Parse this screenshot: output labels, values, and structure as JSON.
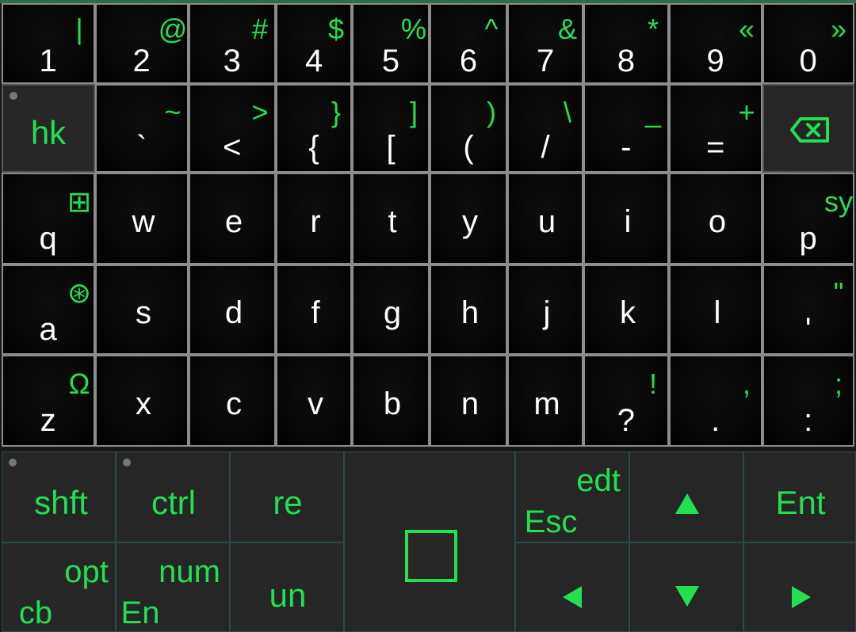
{
  "keyboard": {
    "row1": [
      {
        "main": "1",
        "alt": "|"
      },
      {
        "main": "2",
        "alt": "@"
      },
      {
        "main": "3",
        "alt": "#"
      },
      {
        "main": "4",
        "alt": "$"
      },
      {
        "main": "5",
        "alt": "%"
      },
      {
        "main": "6",
        "alt": "^"
      },
      {
        "main": "7",
        "alt": "&"
      },
      {
        "main": "8",
        "alt": "*"
      },
      {
        "main": "9",
        "alt": "«"
      },
      {
        "main": "0",
        "alt": "»"
      }
    ],
    "row2": [
      {
        "main": "hk",
        "alt": ""
      },
      {
        "main": "`",
        "alt": "~"
      },
      {
        "main": "<",
        "alt": ">"
      },
      {
        "main": "{",
        "alt": "}"
      },
      {
        "main": "[",
        "alt": "]"
      },
      {
        "main": "(",
        "alt": ")"
      },
      {
        "main": "/",
        "alt": "\\"
      },
      {
        "main": "-",
        "alt": "_"
      },
      {
        "main": "=",
        "alt": "+"
      },
      {
        "main": "",
        "alt": "",
        "icon": "backspace-icon"
      }
    ],
    "row3": [
      {
        "main": "q",
        "alt": "⊞"
      },
      {
        "main": "w",
        "alt": ""
      },
      {
        "main": "e",
        "alt": ""
      },
      {
        "main": "r",
        "alt": ""
      },
      {
        "main": "t",
        "alt": ""
      },
      {
        "main": "y",
        "alt": ""
      },
      {
        "main": "u",
        "alt": ""
      },
      {
        "main": "i",
        "alt": ""
      },
      {
        "main": "o",
        "alt": ""
      },
      {
        "main": "p",
        "alt": "sy"
      }
    ],
    "row4": [
      {
        "main": "a",
        "alt": "⊛"
      },
      {
        "main": "s",
        "alt": ""
      },
      {
        "main": "d",
        "alt": ""
      },
      {
        "main": "f",
        "alt": ""
      },
      {
        "main": "g",
        "alt": ""
      },
      {
        "main": "h",
        "alt": ""
      },
      {
        "main": "j",
        "alt": ""
      },
      {
        "main": "k",
        "alt": ""
      },
      {
        "main": "l",
        "alt": ""
      },
      {
        "main": "'",
        "alt": "\""
      }
    ],
    "row5": [
      {
        "main": "z",
        "alt": "Ω"
      },
      {
        "main": "x",
        "alt": ""
      },
      {
        "main": "c",
        "alt": ""
      },
      {
        "main": "v",
        "alt": ""
      },
      {
        "main": "b",
        "alt": ""
      },
      {
        "main": "n",
        "alt": ""
      },
      {
        "main": "m",
        "alt": ""
      },
      {
        "main": "?",
        "alt": "!"
      },
      {
        "main": ".",
        "alt": ","
      },
      {
        "main": ":",
        "alt": ";"
      }
    ]
  },
  "controls": {
    "shift": "shft",
    "ctrl": "ctrl",
    "redo": "re",
    "esc": "Esc",
    "edit": "edt",
    "enter": "Ent",
    "clipboard": "cb",
    "option": "opt",
    "english": "En",
    "number": "num",
    "undo": "un",
    "up_icon": "arrow-up-icon",
    "down_icon": "arrow-down-icon",
    "left_icon": "arrow-left-icon",
    "right_icon": "arrow-right-icon",
    "space_icon": "square-icon"
  },
  "colors": {
    "accent": "#22e052",
    "key_text": "#ffffff",
    "key_bg": "#050505",
    "control_bg": "#262626"
  }
}
